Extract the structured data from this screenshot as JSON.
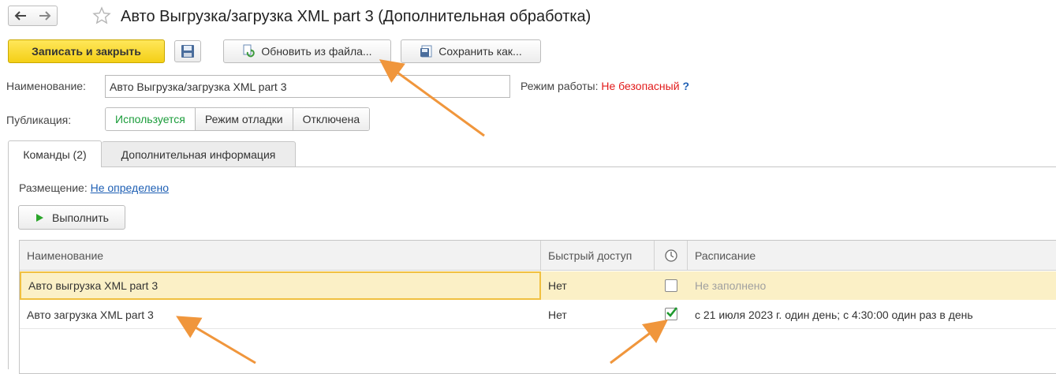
{
  "window": {
    "back_icon": "arrow-left-icon",
    "forward_icon": "arrow-right-icon",
    "favorite_icon": "star-icon",
    "title": "Авто Выгрузка/загрузка XML part 3 (Дополнительная обработка)"
  },
  "toolbar": {
    "save_close_label": "Записать и закрыть",
    "save_icon": "floppy-disk-icon",
    "update_from_file_label": "Обновить из файла...",
    "save_as_label": "Сохранить как..."
  },
  "form": {
    "name_label": "Наименование:",
    "name_value": "Авто Выгрузка/загрузка XML part 3",
    "mode_label": "Режим работы:",
    "mode_value": "Не безопасный",
    "help_label": "?",
    "publication_label": "Публикация:",
    "publication_options": [
      "Используется",
      "Режим отладки",
      "Отключена"
    ],
    "publication_selected": "Используется"
  },
  "tabs": [
    {
      "label": "Команды (2)",
      "active": true
    },
    {
      "label": "Дополнительная информация",
      "active": false
    }
  ],
  "commands": {
    "placement_label": "Размещение:",
    "placement_value": "Не определено",
    "run_label": "Выполнить",
    "columns": [
      "Наименование",
      "Быстрый доступ",
      "clock-icon",
      "Расписание"
    ],
    "rows": [
      {
        "name": "Авто выгрузка XML part 3",
        "quick_access": "Нет",
        "scheduled": false,
        "schedule": "Не заполнено",
        "selected": true
      },
      {
        "name": "Авто загрузка XML part 3",
        "quick_access": "Нет",
        "scheduled": true,
        "schedule": "с 21 июля 2023 г. один день; с 4:30:00 один раз в день",
        "selected": false
      }
    ]
  },
  "colors": {
    "accent_yellow": "#f4cf16",
    "selected_row": "#fbf0c6",
    "danger_text": "#e21b1b",
    "active_green": "#1a9c3a",
    "link_blue": "#1e5fb4",
    "annotation_arrow": "#f0963c"
  }
}
